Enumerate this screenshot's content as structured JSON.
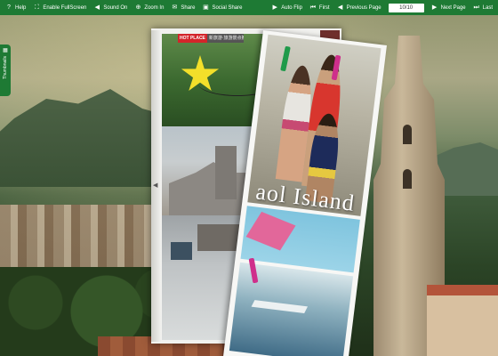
{
  "toolbar": {
    "help_label": "Help",
    "fullscreen_label": "Enable FullScreen",
    "sound_label": "Sound On",
    "zoom_label": "Zoom In",
    "share_label": "Share",
    "social_share_label": "Social Share",
    "autoflip_label": "Auto Flip",
    "first_label": "First",
    "prev_label": "Previous Page",
    "page_value": "10/10",
    "next_label": "Next Page",
    "last_label": "Last"
  },
  "icons": {
    "help": "question-icon",
    "fullscreen": "fullscreen-icon",
    "sound": "speaker-icon",
    "zoom": "zoom-in-icon",
    "share": "share-icon",
    "social": "social-share-icon",
    "autoflip": "play-icon",
    "first": "first-page-icon",
    "prev": "previous-page-icon",
    "next": "next-page-icon",
    "last": "last-page-icon",
    "thumbnails": "grid-icon"
  },
  "thumbnails_tab": {
    "label": "Thumbnails"
  },
  "book": {
    "tag_hot": "HOT PLACE",
    "tag_sub": "新旅游·旅游景点推荐",
    "island_text": "aol Island"
  },
  "colors": {
    "toolbar_bg": "#1e7a34",
    "hot_tag": "#d3242a",
    "star": "#f3df2a"
  }
}
